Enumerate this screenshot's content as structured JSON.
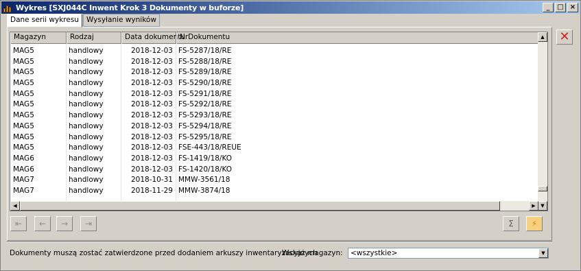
{
  "window": {
    "title": "Wykres [SXJ044C Inwent Krok 3 Dokumenty w buforze]"
  },
  "title_buttons": {
    "minimize": "_",
    "maximize": "□",
    "close": "×"
  },
  "tabs": [
    {
      "label": "Dane serii wykresu"
    },
    {
      "label": "Wysyłanie wyników"
    }
  ],
  "grid": {
    "columns": [
      "Magazyn",
      "Rodzaj",
      "Data dokumentu",
      "NrDokumentu"
    ],
    "rows": [
      {
        "magazyn": "MAG5",
        "rodzaj": "handlowy",
        "data": "2018-12-03",
        "nr": "FS-5287/18/RE"
      },
      {
        "magazyn": "MAG5",
        "rodzaj": "handlowy",
        "data": "2018-12-03",
        "nr": "FS-5288/18/RE"
      },
      {
        "magazyn": "MAG5",
        "rodzaj": "handlowy",
        "data": "2018-12-03",
        "nr": "FS-5289/18/RE"
      },
      {
        "magazyn": "MAG5",
        "rodzaj": "handlowy",
        "data": "2018-12-03",
        "nr": "FS-5290/18/RE"
      },
      {
        "magazyn": "MAG5",
        "rodzaj": "handlowy",
        "data": "2018-12-03",
        "nr": "FS-5291/18/RE"
      },
      {
        "magazyn": "MAG5",
        "rodzaj": "handlowy",
        "data": "2018-12-03",
        "nr": "FS-5292/18/RE"
      },
      {
        "magazyn": "MAG5",
        "rodzaj": "handlowy",
        "data": "2018-12-03",
        "nr": "FS-5293/18/RE"
      },
      {
        "magazyn": "MAG5",
        "rodzaj": "handlowy",
        "data": "2018-12-03",
        "nr": "FS-5294/18/RE"
      },
      {
        "magazyn": "MAG5",
        "rodzaj": "handlowy",
        "data": "2018-12-03",
        "nr": "FS-5295/18/RE"
      },
      {
        "magazyn": "MAG5",
        "rodzaj": "handlowy",
        "data": "2018-12-03",
        "nr": "FSE-443/18/REUE"
      },
      {
        "magazyn": "MAG6",
        "rodzaj": "handlowy",
        "data": "2018-12-03",
        "nr": "FS-1419/18/KO"
      },
      {
        "magazyn": "MAG6",
        "rodzaj": "handlowy",
        "data": "2018-12-03",
        "nr": "FS-1420/18/KO"
      },
      {
        "magazyn": "MAG7",
        "rodzaj": "handlowy",
        "data": "2018-10-31",
        "nr": "MMW-3561/18"
      },
      {
        "magazyn": "MAG7",
        "rodzaj": "handlowy",
        "data": "2018-11-29",
        "nr": "MMW-3874/18"
      }
    ]
  },
  "footer": {
    "info_text": "Dokumenty muszą zostać zatwierdzone przed dodaniem arkuszy inwentaryzacyjnych",
    "magazyn_label": "Wskaż magazyn:",
    "magazyn_value": "<wszystkie>"
  }
}
